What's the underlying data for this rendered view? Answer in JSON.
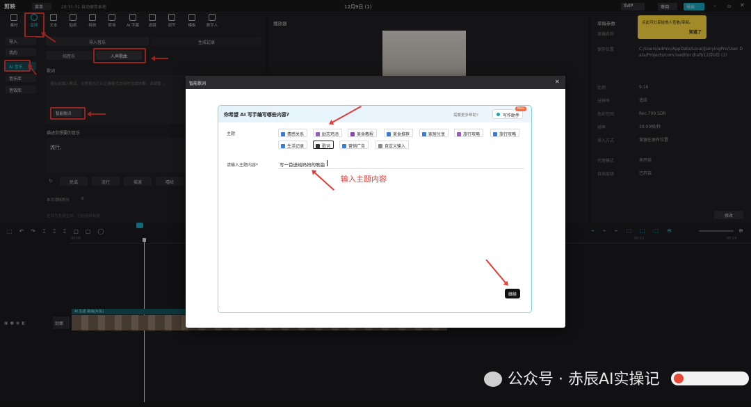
{
  "titlebar": {
    "logo": "剪映",
    "menu": "菜单",
    "autosave": "20:31:31 自动保存本地",
    "doc_title": "12月9日 (1)",
    "svip": "SVIP",
    "review": "审阅",
    "export": "导出"
  },
  "tools": [
    "素材",
    "音频",
    "文本",
    "贴纸",
    "特效",
    "转场",
    "AI 字幕",
    "滤镜",
    "调节",
    "模板",
    "数字人"
  ],
  "sidebar": [
    "导入",
    "我的",
    "AI 音乐",
    "音乐库",
    "音效库"
  ],
  "music_panel": {
    "tab_left": "导入音乐",
    "tab_right": "生成记录",
    "seg_pure": "纯音乐",
    "seg_vocal": "人声歌曲",
    "lyrics_label": "歌词",
    "lyrics_placeholder": "请在此输入歌词，注意格式已以正确格式支持的生成效果，请调整 ...",
    "smart_lyrics_btn": "智能歌词",
    "describe_label": "描述你想要的音乐",
    "style_value": "流行,",
    "chips": [
      "民谣",
      "流行",
      "摇滚",
      "嘻哈"
    ],
    "cost": "本次消耗积分",
    "cost_value": "0",
    "credit_hint": "第一次生成后免费",
    "generate_hint": "全部为免费生成，已经持续有效"
  },
  "player": {
    "title": "播放器"
  },
  "details": {
    "title": "草稿参数",
    "rows": [
      [
        "草稿名称",
        "12月9日 (1)"
      ],
      [
        "保存位置",
        "C:/Users/admin/AppData/Local/JianyingPro/User Data/Projects/com.lveditor.draft/12月9日 (1)"
      ],
      [
        "比例",
        "9:16"
      ],
      [
        "分辨率",
        "适应"
      ],
      [
        "色彩空间",
        "Rec.709 SDR"
      ],
      [
        "帧率",
        "30.00帧/秒"
      ],
      [
        "导入方式",
        "保留在原有位置"
      ],
      [
        "代理模式",
        "未开启"
      ],
      [
        "自由层级",
        "已开启"
      ]
    ],
    "edit_btn": "修改"
  },
  "tooltip": {
    "text": "点此可分享给他人查看/审阅。",
    "ok": "知道了"
  },
  "modal": {
    "title": "智能歌词",
    "question": "你希望 AI 写手编写哪些内容?",
    "help": "需要更多帮助?",
    "assistant": "写作助手",
    "new_badge": "New",
    "theme_label": "主题",
    "tags_row1": [
      "情感关系",
      "励志鸡汤",
      "美食教程",
      "美食推荐",
      "家居分享",
      "旅行攻略",
      "旅行攻略"
    ],
    "tags_row2": [
      "生活记录",
      "歌词",
      "营销广告",
      "自定义输入"
    ],
    "input_label": "请输入主题内容*",
    "input_value": "写一首送给妈妈的歌曲",
    "continue": "继续"
  },
  "annotation": {
    "text": "输入主题内容"
  },
  "timeline": {
    "track_label": "AI 生成  歌曲[片段]",
    "cover_label": "封面",
    "time_marks": [
      "00:00",
      "00:10",
      "00:20",
      "00:12",
      "00:14"
    ]
  },
  "watermark": {
    "text": "公众号 · 赤辰AI实操记"
  },
  "colors": {
    "accent": "#22c3d9",
    "annotation_red": "#e53935",
    "tooltip_yellow": "#f7d43c"
  }
}
